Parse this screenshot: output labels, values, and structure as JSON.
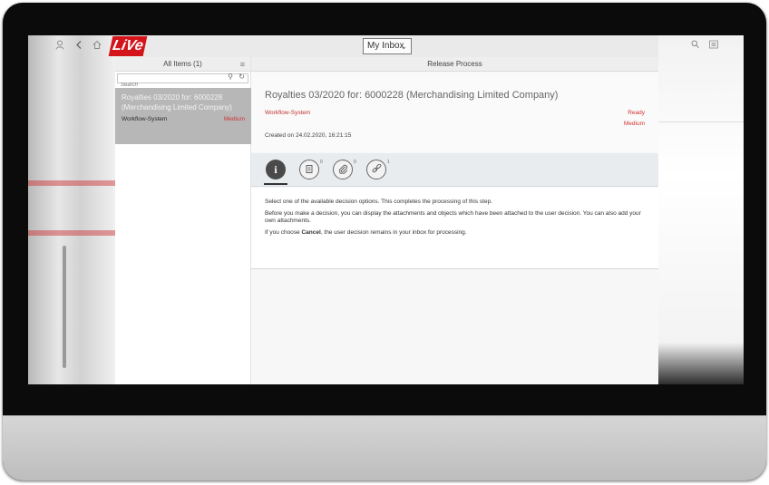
{
  "shell": {
    "app_logo_text": "LiVe",
    "inbox_selector": "My Inbox",
    "icons": [
      "user-icon",
      "back-icon",
      "home-icon",
      "search-icon",
      "menu-icon"
    ]
  },
  "master": {
    "title": "All Items (1)",
    "search_placeholder": "Search",
    "items": [
      {
        "title": "Royalties 03/2020 for: 6000228 (Merchandising Limited Company)",
        "created_by": "Workflow-System",
        "priority": "Medium"
      }
    ]
  },
  "detail": {
    "header_title": "Release Process",
    "task_title": "Royalties 03/2020 for: 6000228 (Merchandising Limited Company)",
    "created_by": "Workflow-System",
    "status": "Ready",
    "priority": "Medium",
    "created_on": "Created on 24.02.2020, 16:21:15",
    "tabs": [
      {
        "name": "info",
        "count": ""
      },
      {
        "name": "notes",
        "count": "0"
      },
      {
        "name": "attachments",
        "count": "0"
      },
      {
        "name": "related-objects",
        "count": "1"
      }
    ],
    "description": {
      "p1": "Select one of the available decision options. This completes the processing of this step.",
      "p2": "Before you make a decision, you can display the attachments and objects which have been attached to the user decision. You can also add your own attachments.",
      "p3_prefix": "If you choose ",
      "p3_bold": "Cancel",
      "p3_suffix": ", the user decision remains in your inbox for processing."
    }
  },
  "colors": {
    "accent_red": "#d23131",
    "logo_red": "#d3141b",
    "selected_item": "#b7b7b7"
  }
}
